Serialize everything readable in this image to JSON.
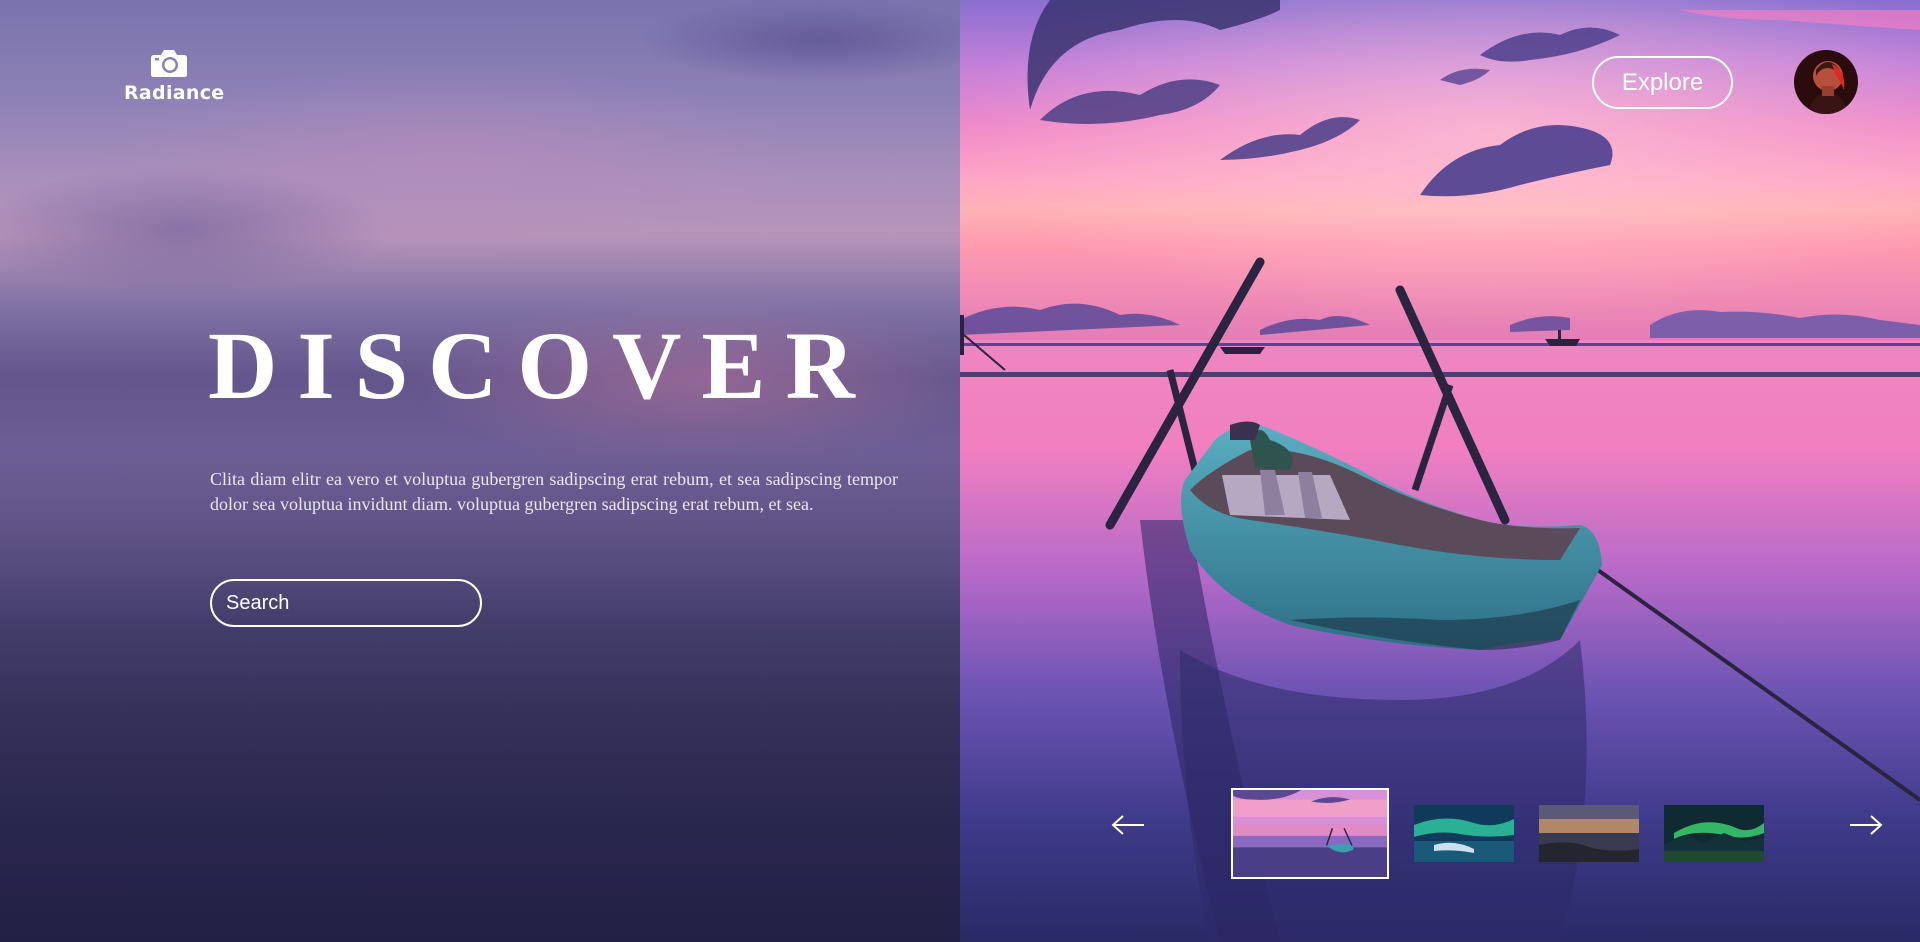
{
  "brand": {
    "name": "Radiance",
    "icon": "camera-icon"
  },
  "hero": {
    "title": "DISCOVER",
    "description": "Clita diam elitr ea vero et voluptua gubergren sadipscing erat rebum, et sea sadipscing tempor dolor sea voluptua invidunt diam. voluptua gubergren sadipscing erat rebum, et sea."
  },
  "search": {
    "placeholder": "Search",
    "value": ""
  },
  "header": {
    "explore_label": "Explore",
    "avatar_icon": "user-avatar"
  },
  "gallery": {
    "prev_icon": "arrow-left-icon",
    "next_icon": "arrow-right-icon",
    "selected_index": 0,
    "thumbnails": [
      {
        "subject": "boat-sunset",
        "selected": true
      },
      {
        "subject": "aurora-lake",
        "selected": false
      },
      {
        "subject": "rocky-shore-dusk",
        "selected": false
      },
      {
        "subject": "aurora-mountains",
        "selected": false
      }
    ]
  },
  "colors": {
    "accent": "#ffffff",
    "sky_pink": "#f07ec0",
    "sky_violet": "#9c73d6",
    "water_deep": "#2d2a62",
    "boat_teal": "#3aa7b8"
  }
}
